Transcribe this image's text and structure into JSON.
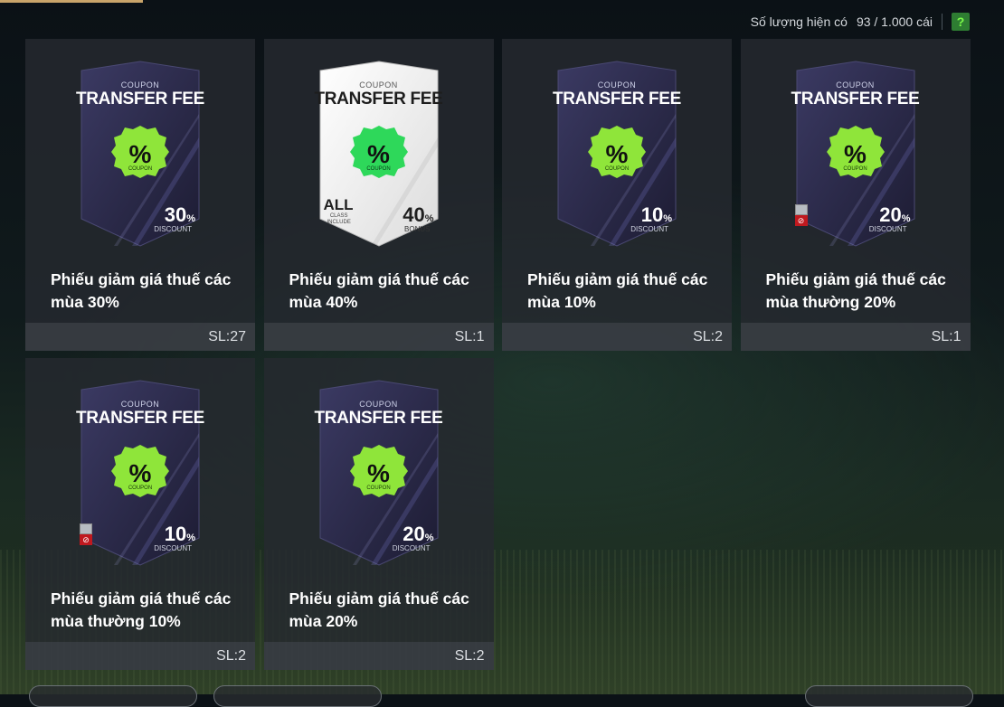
{
  "header": {
    "quantity_label": "Số lượng hiện có",
    "quantity_value": "93 / 1.000 cái",
    "help_label": "?"
  },
  "coupon_art": {
    "small_text": "COUPON",
    "big_text": "TRANSFER FEE",
    "seal_symbol": "%",
    "seal_text": "COUPON"
  },
  "items": [
    {
      "value": "30",
      "unit": "%",
      "sub": "DISCOUNT",
      "style": "dark",
      "restricted": false,
      "name": "Phiếu giảm giá thuế các mùa 30%",
      "qty": "SL:27"
    },
    {
      "value": "40",
      "unit": "%",
      "sub": "BONUS",
      "style": "white",
      "all_label": "ALL",
      "all_sub_1": "CLASS",
      "all_sub_2": "INCLUDE",
      "restricted": false,
      "name": "Phiếu giảm giá thuế các mùa 40%",
      "qty": "SL:1"
    },
    {
      "value": "10",
      "unit": "%",
      "sub": "DISCOUNT",
      "style": "dark",
      "restricted": false,
      "name": "Phiếu giảm giá thuế các mùa 10%",
      "qty": "SL:2"
    },
    {
      "value": "20",
      "unit": "%",
      "sub": "DISCOUNT",
      "style": "dark",
      "restricted": true,
      "name": "Phiếu giảm giá thuế các mùa thường 20%",
      "qty": "SL:1"
    },
    {
      "value": "10",
      "unit": "%",
      "sub": "DISCOUNT",
      "style": "dark",
      "restricted": true,
      "name": "Phiếu giảm giá thuế các mùa thường 10%",
      "qty": "SL:2"
    },
    {
      "value": "20",
      "unit": "%",
      "sub": "DISCOUNT",
      "style": "dark",
      "restricted": false,
      "name": "Phiếu giảm giá thuế các mùa 20%",
      "qty": "SL:2"
    }
  ],
  "colors": {
    "seal_green": "#8fe53a",
    "card_dark": "#2c2b4a",
    "card_white": "#f4f4f4",
    "help_green": "#2e7d32",
    "restricted_red": "#c0191f"
  }
}
